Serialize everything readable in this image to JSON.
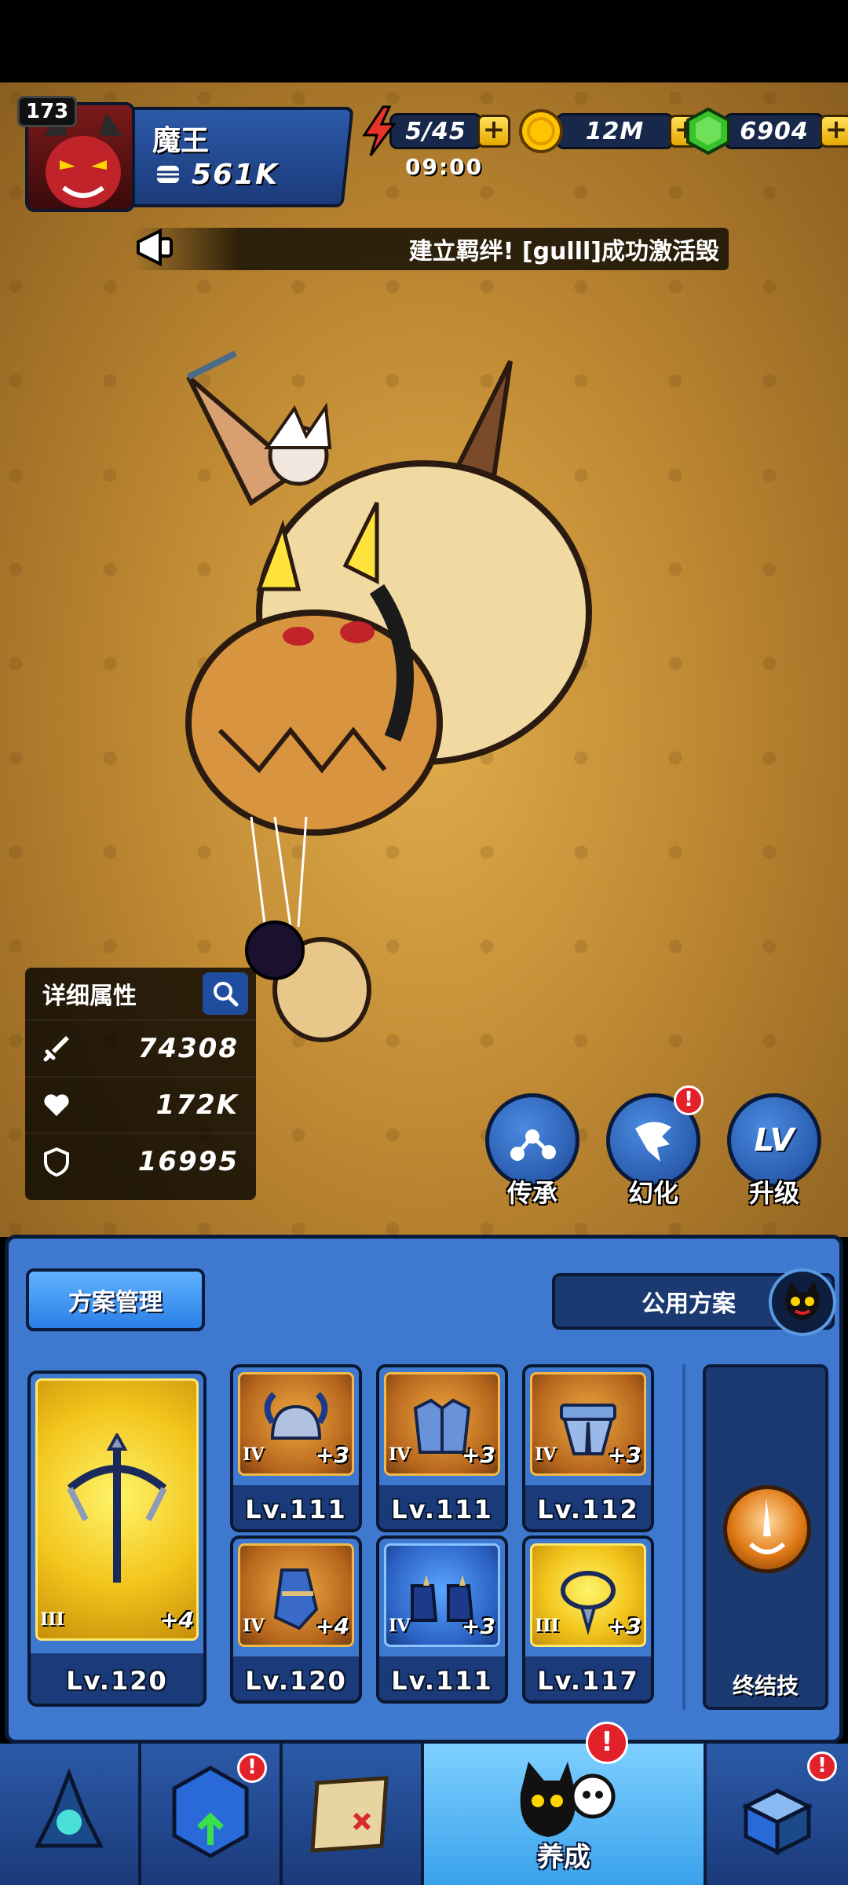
{
  "player": {
    "level": "173",
    "name": "魔王",
    "power": "561K"
  },
  "resources": {
    "energy": {
      "value": "5/45",
      "timer": "09:00",
      "icon": "lightning-icon"
    },
    "gold": {
      "value": "12M",
      "icon": "gold-coin-icon"
    },
    "gems": {
      "value": "6904",
      "icon": "green-gem-icon"
    },
    "plus_label": "+"
  },
  "broadcast": {
    "text": "建立羁绊! [gulll]成功激活毁"
  },
  "stats": {
    "title": "详细属性",
    "attack": "74308",
    "hp": "172K",
    "defense": "16995"
  },
  "actions": [
    {
      "label": "传承",
      "icon": "inherit-icon"
    },
    {
      "label": "幻化",
      "icon": "transform-icon",
      "alert": "!"
    },
    {
      "label": "升级",
      "icon": "level-up-icon",
      "badge_text": "LV"
    }
  ],
  "equipment": {
    "plan_button": "方案管理",
    "public_plan": "公用方案",
    "main_weapon": {
      "tier": "III",
      "plus": "+4",
      "level": "Lv.120"
    },
    "slots": [
      {
        "name": "helmet",
        "tier": "IV",
        "plus": "+3",
        "level": "Lv.111"
      },
      {
        "name": "chest-armor",
        "tier": "IV",
        "plus": "+3",
        "level": "Lv.111"
      },
      {
        "name": "leg-armor",
        "tier": "IV",
        "plus": "+3",
        "level": "Lv.112"
      },
      {
        "name": "gauntlet",
        "tier": "IV",
        "plus": "+4",
        "level": "Lv.120"
      },
      {
        "name": "boots",
        "tier": "IV",
        "plus": "+3",
        "level": "Lv.111"
      },
      {
        "name": "necklace",
        "tier": "III",
        "plus": "+3",
        "level": "Lv.117"
      }
    ],
    "ultimate_label": "终结技"
  },
  "nav": {
    "active_label": "养成",
    "alert": "!"
  },
  "colors": {
    "panel_blue": "#3e78cf",
    "dark_navy": "#0c1a3a",
    "gold": "#f2c51c",
    "alert_red": "#e3212b"
  }
}
